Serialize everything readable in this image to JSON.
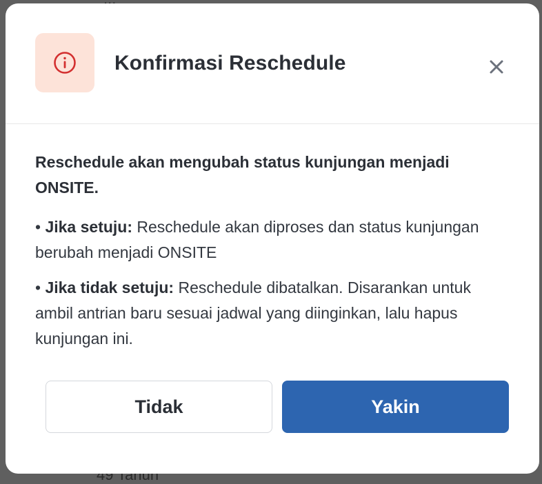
{
  "dialog": {
    "title": "Konfirmasi Reschedule",
    "alert_icon": "info-circle-icon",
    "close_icon": "close-icon",
    "accent_color": "#d32f2f",
    "icon_tile_color": "#fde3d9",
    "lead": "Reschedule akan mengubah status kunjungan menjadi ONSITE.",
    "agree": {
      "label": "Jika setuju:",
      "text": " Reschedule akan diproses dan status kunjungan berubah menjadi ONSITE"
    },
    "disagree": {
      "label": "Jika tidak setuju:",
      "text": " Reschedule dibatalkan. Disarankan untuk ambil antrian baru sesuai jadwal yang diinginkan, lalu hapus kunjungan ini."
    },
    "bullet": "•",
    "buttons": {
      "cancel_label": "Tidak",
      "confirm_label": "Yakin",
      "confirm_color": "#2d65b0"
    }
  },
  "background": {
    "top_text": "...",
    "bottom_text": "49 Tahun"
  }
}
